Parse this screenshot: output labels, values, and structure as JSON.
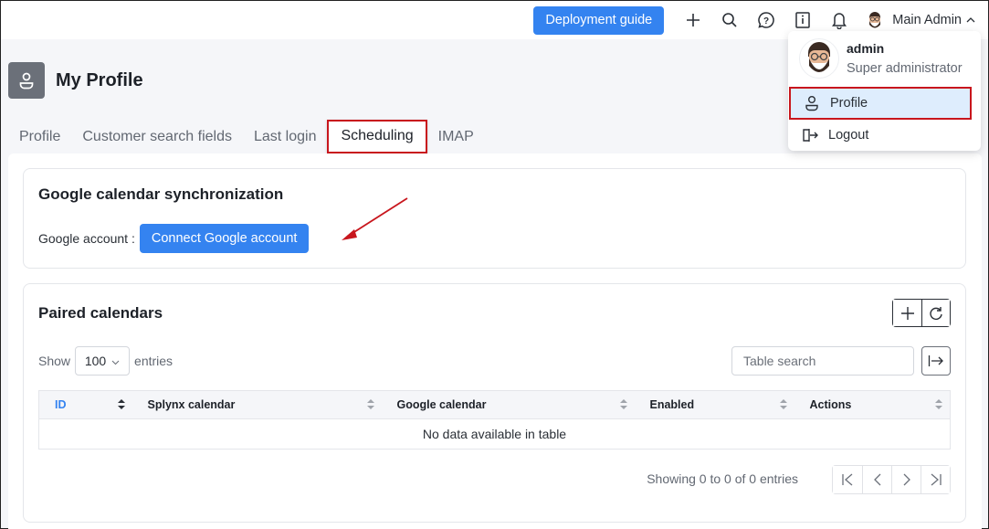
{
  "topbar": {
    "deployment_guide_label": "Deployment guide",
    "icons": [
      "plus-icon",
      "search-icon",
      "help-icon",
      "info-book-icon",
      "bell-icon"
    ],
    "user_name": "Main Admin"
  },
  "user_dropdown": {
    "username": "admin",
    "role": "Super administrator",
    "items": [
      {
        "label": "Profile",
        "icon": "user-icon",
        "highlighted": true
      },
      {
        "label": "Logout",
        "icon": "logout-icon",
        "highlighted": false
      }
    ]
  },
  "page": {
    "title": "My Profile",
    "tabs": [
      {
        "label": "Profile",
        "active": false
      },
      {
        "label": "Customer search fields",
        "active": false
      },
      {
        "label": "Last login",
        "active": false
      },
      {
        "label": "Scheduling",
        "active": true
      },
      {
        "label": "IMAP",
        "active": false
      }
    ]
  },
  "sync_panel": {
    "title": "Google calendar synchronization",
    "account_label": "Google account :",
    "connect_button_label": "Connect Google account"
  },
  "paired_panel": {
    "title": "Paired calendars",
    "show_label": "Show",
    "entries_label": "entries",
    "page_length": "100",
    "search_placeholder": "Table search",
    "columns": [
      "ID",
      "Splynx calendar",
      "Google calendar",
      "Enabled",
      "Actions"
    ],
    "sorted_column": "ID",
    "empty_message": "No data available in table",
    "info": "Showing 0 to 0 of 0 entries"
  },
  "colors": {
    "primary": "#3483f0",
    "highlight_border": "#c8161d",
    "highlight_bg": "#deedfd"
  }
}
